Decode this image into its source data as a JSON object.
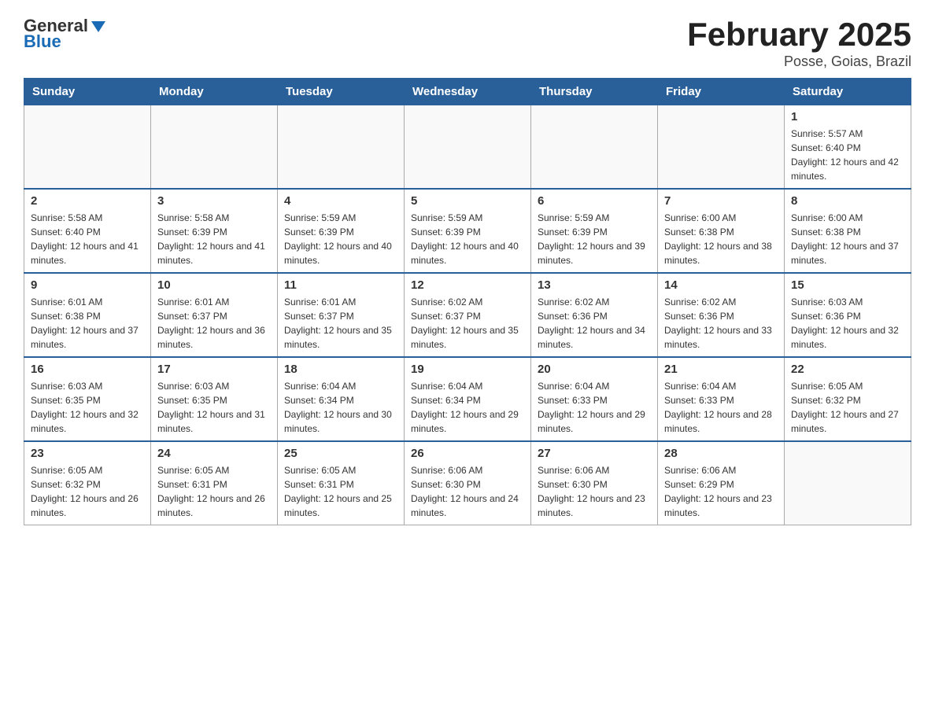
{
  "header": {
    "logo_general": "General",
    "logo_blue": "Blue",
    "month_title": "February 2025",
    "location": "Posse, Goias, Brazil"
  },
  "weekdays": [
    "Sunday",
    "Monday",
    "Tuesday",
    "Wednesday",
    "Thursday",
    "Friday",
    "Saturday"
  ],
  "rows": [
    {
      "days": [
        {
          "number": "",
          "info": ""
        },
        {
          "number": "",
          "info": ""
        },
        {
          "number": "",
          "info": ""
        },
        {
          "number": "",
          "info": ""
        },
        {
          "number": "",
          "info": ""
        },
        {
          "number": "",
          "info": ""
        },
        {
          "number": "1",
          "info": "Sunrise: 5:57 AM\nSunset: 6:40 PM\nDaylight: 12 hours and 42 minutes."
        }
      ]
    },
    {
      "days": [
        {
          "number": "2",
          "info": "Sunrise: 5:58 AM\nSunset: 6:40 PM\nDaylight: 12 hours and 41 minutes."
        },
        {
          "number": "3",
          "info": "Sunrise: 5:58 AM\nSunset: 6:39 PM\nDaylight: 12 hours and 41 minutes."
        },
        {
          "number": "4",
          "info": "Sunrise: 5:59 AM\nSunset: 6:39 PM\nDaylight: 12 hours and 40 minutes."
        },
        {
          "number": "5",
          "info": "Sunrise: 5:59 AM\nSunset: 6:39 PM\nDaylight: 12 hours and 40 minutes."
        },
        {
          "number": "6",
          "info": "Sunrise: 5:59 AM\nSunset: 6:39 PM\nDaylight: 12 hours and 39 minutes."
        },
        {
          "number": "7",
          "info": "Sunrise: 6:00 AM\nSunset: 6:38 PM\nDaylight: 12 hours and 38 minutes."
        },
        {
          "number": "8",
          "info": "Sunrise: 6:00 AM\nSunset: 6:38 PM\nDaylight: 12 hours and 37 minutes."
        }
      ]
    },
    {
      "days": [
        {
          "number": "9",
          "info": "Sunrise: 6:01 AM\nSunset: 6:38 PM\nDaylight: 12 hours and 37 minutes."
        },
        {
          "number": "10",
          "info": "Sunrise: 6:01 AM\nSunset: 6:37 PM\nDaylight: 12 hours and 36 minutes."
        },
        {
          "number": "11",
          "info": "Sunrise: 6:01 AM\nSunset: 6:37 PM\nDaylight: 12 hours and 35 minutes."
        },
        {
          "number": "12",
          "info": "Sunrise: 6:02 AM\nSunset: 6:37 PM\nDaylight: 12 hours and 35 minutes."
        },
        {
          "number": "13",
          "info": "Sunrise: 6:02 AM\nSunset: 6:36 PM\nDaylight: 12 hours and 34 minutes."
        },
        {
          "number": "14",
          "info": "Sunrise: 6:02 AM\nSunset: 6:36 PM\nDaylight: 12 hours and 33 minutes."
        },
        {
          "number": "15",
          "info": "Sunrise: 6:03 AM\nSunset: 6:36 PM\nDaylight: 12 hours and 32 minutes."
        }
      ]
    },
    {
      "days": [
        {
          "number": "16",
          "info": "Sunrise: 6:03 AM\nSunset: 6:35 PM\nDaylight: 12 hours and 32 minutes."
        },
        {
          "number": "17",
          "info": "Sunrise: 6:03 AM\nSunset: 6:35 PM\nDaylight: 12 hours and 31 minutes."
        },
        {
          "number": "18",
          "info": "Sunrise: 6:04 AM\nSunset: 6:34 PM\nDaylight: 12 hours and 30 minutes."
        },
        {
          "number": "19",
          "info": "Sunrise: 6:04 AM\nSunset: 6:34 PM\nDaylight: 12 hours and 29 minutes."
        },
        {
          "number": "20",
          "info": "Sunrise: 6:04 AM\nSunset: 6:33 PM\nDaylight: 12 hours and 29 minutes."
        },
        {
          "number": "21",
          "info": "Sunrise: 6:04 AM\nSunset: 6:33 PM\nDaylight: 12 hours and 28 minutes."
        },
        {
          "number": "22",
          "info": "Sunrise: 6:05 AM\nSunset: 6:32 PM\nDaylight: 12 hours and 27 minutes."
        }
      ]
    },
    {
      "days": [
        {
          "number": "23",
          "info": "Sunrise: 6:05 AM\nSunset: 6:32 PM\nDaylight: 12 hours and 26 minutes."
        },
        {
          "number": "24",
          "info": "Sunrise: 6:05 AM\nSunset: 6:31 PM\nDaylight: 12 hours and 26 minutes."
        },
        {
          "number": "25",
          "info": "Sunrise: 6:05 AM\nSunset: 6:31 PM\nDaylight: 12 hours and 25 minutes."
        },
        {
          "number": "26",
          "info": "Sunrise: 6:06 AM\nSunset: 6:30 PM\nDaylight: 12 hours and 24 minutes."
        },
        {
          "number": "27",
          "info": "Sunrise: 6:06 AM\nSunset: 6:30 PM\nDaylight: 12 hours and 23 minutes."
        },
        {
          "number": "28",
          "info": "Sunrise: 6:06 AM\nSunset: 6:29 PM\nDaylight: 12 hours and 23 minutes."
        },
        {
          "number": "",
          "info": ""
        }
      ]
    }
  ]
}
